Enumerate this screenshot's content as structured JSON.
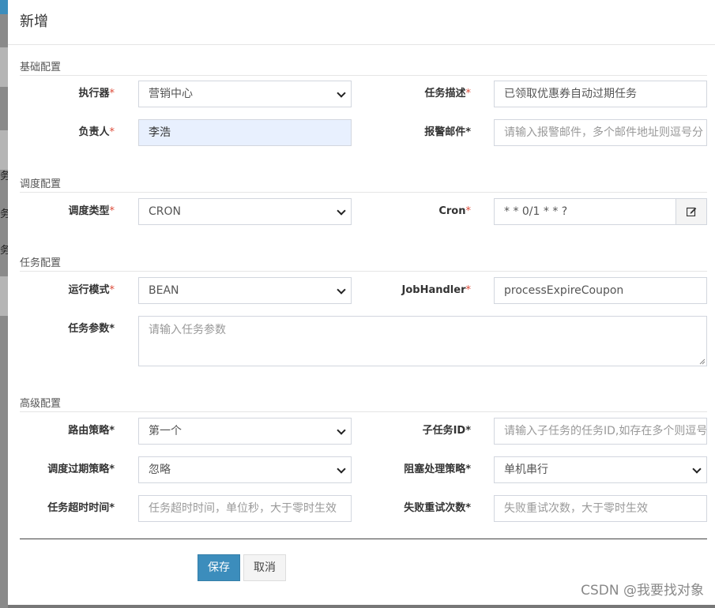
{
  "modal": {
    "title": "新增"
  },
  "sections": {
    "basic": "基础配置",
    "schedule": "调度配置",
    "task": "任务配置",
    "advanced": "高级配置"
  },
  "required_mark": "*",
  "fields": {
    "executor": {
      "label": "执行器",
      "value": "营销中心"
    },
    "job_desc": {
      "label": "任务描述",
      "value": "已领取优惠券自动过期任务"
    },
    "author": {
      "label": "负责人",
      "value": "李浩"
    },
    "alarm_email": {
      "label": "报警邮件*",
      "placeholder": "请输入报警邮件，多个邮件地址则逗号分"
    },
    "schedule_type": {
      "label": "调度类型",
      "value": "CRON"
    },
    "cron": {
      "label": "Cron",
      "value": "* * 0/1 * * ?"
    },
    "run_mode": {
      "label": "运行模式",
      "value": "BEAN"
    },
    "job_handler": {
      "label": "JobHandler",
      "value": "processExpireCoupon"
    },
    "job_param": {
      "label": "任务参数*",
      "placeholder": "请输入任务参数"
    },
    "route_strategy": {
      "label": "路由策略*",
      "value": "第一个"
    },
    "child_job_id": {
      "label": "子任务ID*",
      "placeholder": "请输入子任务的任务ID,如存在多个则逗号"
    },
    "misfire_strategy": {
      "label": "调度过期策略*",
      "value": "忽略"
    },
    "block_strategy": {
      "label": "阻塞处理策略*",
      "value": "单机串行"
    },
    "timeout": {
      "label": "任务超时时间*",
      "placeholder": "任务超时时间，单位秒，大于零时生效"
    },
    "fail_retry": {
      "label": "失败重试次数*",
      "placeholder": "失败重试次数，大于零时生效"
    }
  },
  "buttons": {
    "save": "保存",
    "cancel": "取消"
  },
  "watermark": "CSDN @我要找对象",
  "backdrop_glyphs": [
    "务",
    "务",
    "务"
  ],
  "icons": {
    "cron_edit": "edit-icon"
  },
  "colors": {
    "primary": "#3c8dbc",
    "required": "#dd4b39",
    "autofill": "#e8f0fe"
  }
}
